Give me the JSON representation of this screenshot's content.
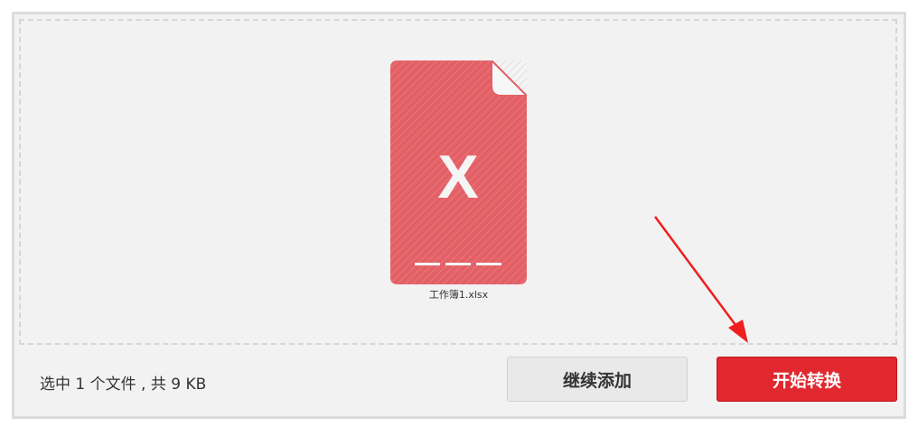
{
  "colors": {
    "file_icon": "#e36066",
    "accent": "#e0282e",
    "arrow": "#f01e1e"
  },
  "file": {
    "name": "工作簿1.xlsx",
    "icon": "excel-file-icon",
    "icon_letter": "X"
  },
  "footer": {
    "summary": "选中 1 个文件 , 共 9 KB",
    "continue_label": "继续添加",
    "start_label": "开始转换"
  },
  "annotation": {
    "icon": "red-arrow-icon"
  }
}
